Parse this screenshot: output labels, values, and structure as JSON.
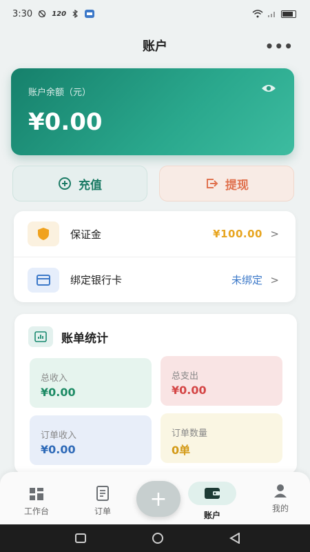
{
  "status_bar": {
    "time": "3:30",
    "network_speed": "120",
    "icons": [
      "do-not-disturb-icon",
      "bluetooth-icon",
      "app-badge-icon",
      "wifi-icon",
      "signal-icon",
      "battery-icon"
    ]
  },
  "header": {
    "title": "账户",
    "more_icon": "more-icon"
  },
  "balance": {
    "label": "账户余额（元）",
    "amount": "¥0.00",
    "eye_icon": "eye-icon"
  },
  "actions": {
    "charge_label": "充值",
    "withdraw_label": "提现"
  },
  "list": {
    "deposit": {
      "label": "保证金",
      "value": "¥100.00"
    },
    "bank_card": {
      "label": "绑定银行卡",
      "value": "未绑定"
    }
  },
  "stats": {
    "title": "账单统计",
    "total_income": {
      "label": "总收入",
      "value": "¥0.00"
    },
    "total_expense": {
      "label": "总支出",
      "value": "¥0.00"
    },
    "order_income": {
      "label": "订单收入",
      "value": "¥0.00"
    },
    "order_count": {
      "label": "订单数量",
      "value": "0单"
    }
  },
  "bottom_nav": {
    "workbench": "工作台",
    "orders": "订单",
    "add": "+",
    "account": "账户",
    "mine": "我的"
  },
  "colors": {
    "primary": "#1a8a70",
    "withdraw": "#e0724f",
    "deposit_value": "#e7a520",
    "bank_value": "#3b78c8"
  }
}
